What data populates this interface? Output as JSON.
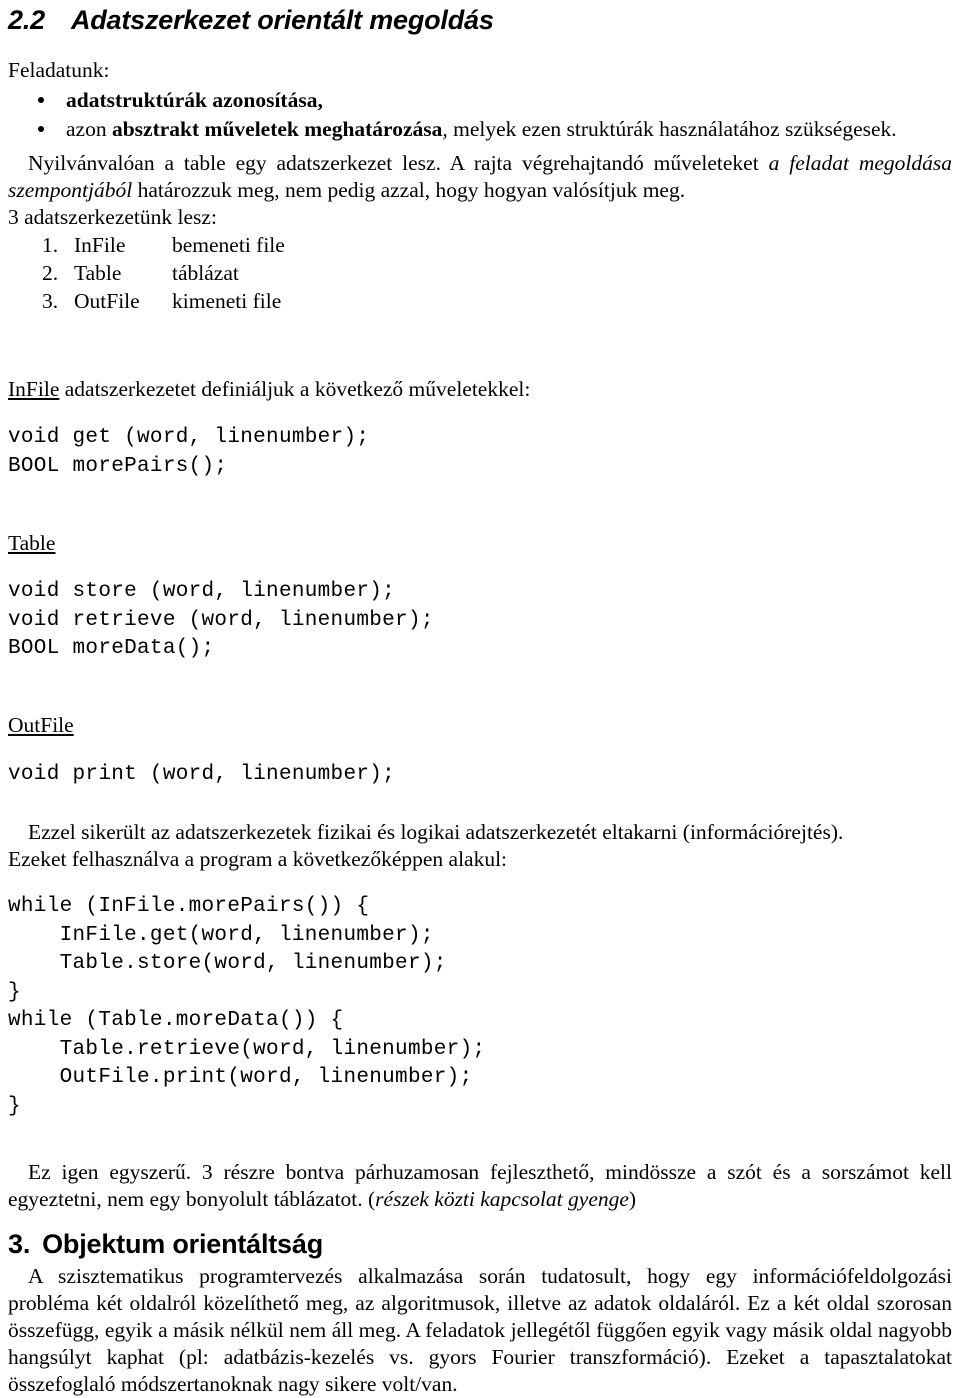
{
  "document": {
    "heading_1": {
      "number": "2.2",
      "title": "Adatszerkezet orientált megoldás"
    },
    "lead_label": "Feladatunk:",
    "bullets": [
      {
        "bold_prefix": "adatstruktúrák azonosítása,",
        "rest": ""
      },
      {
        "lead": "azon ",
        "bold_prefix": "absztrakt műveletek meghatározása",
        "rest": ", melyek ezen struktúrák használatához szükségesek."
      }
    ],
    "paragraph_table": {
      "part1": "Nyilvánvalóan a table egy adatszerkezet lesz. A rajta végrehajtandó műveleteket ",
      "italic": "a feladat megoldása szempontjából",
      "part2": " határozzuk meg, nem pedig azzal, hogy hogyan valósítjuk meg."
    },
    "count_line": "3 adatszerkezetünk lesz:",
    "numbered_list": [
      {
        "num": "1.",
        "name": "InFile",
        "desc": "bemeneti file"
      },
      {
        "num": "2.",
        "name": "Table",
        "desc": "táblázat"
      },
      {
        "num": "3.",
        "name": "OutFile",
        "desc": "kimeneti file"
      }
    ],
    "infile_intro": {
      "underlined": "InFile",
      "rest": " adatszerkezetet definiáljuk a következő műveletekkel:"
    },
    "infile_code": "void get (word, linenumber);\nBOOL morePairs();",
    "table_label": "Table",
    "table_code": "void store (word, linenumber);\nvoid retrieve (word, linenumber);\nBOOL moreData();",
    "outfile_label": "OutFile",
    "outfile_code": "void print (word, linenumber);",
    "paragraph_hiding": "Ezzel sikerült az adatszerkezetek fizikai és logikai adatszerkezetét eltakarni (információrejtés).",
    "paragraph_usage": "Ezeket felhasználva a program a következőképpen alakul:",
    "program_code": "while (InFile.morePairs()) {\n    InFile.get(word, linenumber);\n    Table.store(word, linenumber);\n}\nwhile (Table.moreData()) {\n    Table.retrieve(word, linenumber);\n    OutFile.print(word, linenumber);\n}",
    "paragraph_simple": {
      "part1": "Ez igen egyszerű. 3 részre bontva párhuzamosan fejleszthető, mindössze a szót és a sorszámot kell egyeztetni, nem egy bonyolult táblázatot. (",
      "italic": "részek közti kapcsolat gyenge",
      "part2": ")"
    },
    "heading_2": {
      "number": "3.",
      "title": "Objektum orientáltság"
    },
    "paragraph_oo": "A szisztematikus programtervezés alkalmazása során tudatosult, hogy egy információfeldolgozási probléma két oldalról közelíthető meg, az algoritmusok, illetve az adatok oldaláról. Ez a két oldal szorosan összefügg, egyik a másik nélkül nem áll meg. A feladatok jellegétől függően egyik vagy másik oldal nagyobb hangsúlyt kaphat (pl: adatbázis-kezelés vs. gyors Fourier transzformáció). Ezeket a tapasztalatokat összefoglaló módszertanoknak nagy sikere volt/van."
  }
}
